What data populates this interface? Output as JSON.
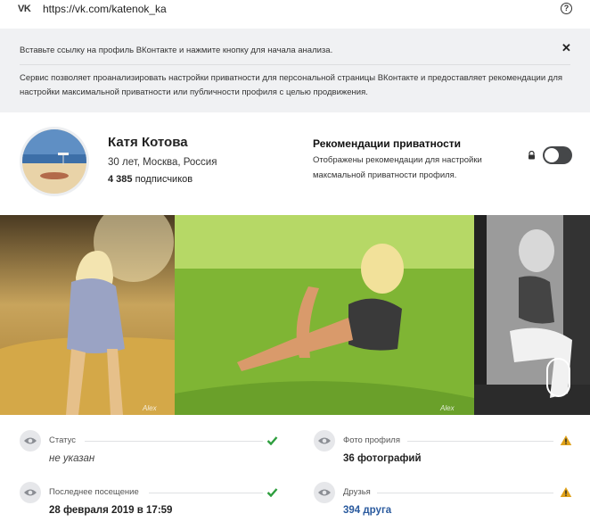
{
  "browser": {
    "logo": "VK",
    "url": "https://vk.com/katenok_ka",
    "help_glyph": "?"
  },
  "notice": {
    "line1": "Вставьте ссылку на профиль ВКонтакте и нажмите кнопку для начала анализа.",
    "line2": "Сервис позволяет проанализировать настройки приватности для персональной страницы ВКонтакте и предоставляет рекомендации для настройки максимальной приватности или публичности профиля с целью продвижения.",
    "close_glyph": "✕"
  },
  "profile": {
    "name": "Катя Котова",
    "meta": "30 лет, Москва, Россия",
    "subscribers_count": "4 385",
    "subscribers_label": "подписчиков"
  },
  "recommendations": {
    "title": "Рекомендации приватности",
    "description": "Отображены рекомендации для настройки максмальной приватности профиля.",
    "toggle_on": false
  },
  "photos": {
    "captions": [
      "Alex",
      "Alex"
    ]
  },
  "fields": [
    {
      "label": "Статус",
      "value": "не указан",
      "status": "ok",
      "style": "italic"
    },
    {
      "label": "Фото профиля",
      "value": "36 фотографий",
      "status": "warning",
      "style": "bold"
    },
    {
      "label": "Последнее посещение",
      "value": "28 февраля 2019 в 17:59",
      "status": "ok",
      "style": "bold"
    },
    {
      "label": "Друзья",
      "value": "394 друга",
      "status": "warning",
      "style": "link"
    }
  ],
  "colors": {
    "ok": "#2e9e3e",
    "warning": "#e0a21b",
    "link": "#2a5a9e",
    "toggle_off": "#454749"
  },
  "icons": {
    "field_icon": "eye-icon",
    "ok_icon": "check-icon",
    "warning_icon": "warning-icon",
    "lock": "lock-icon"
  }
}
